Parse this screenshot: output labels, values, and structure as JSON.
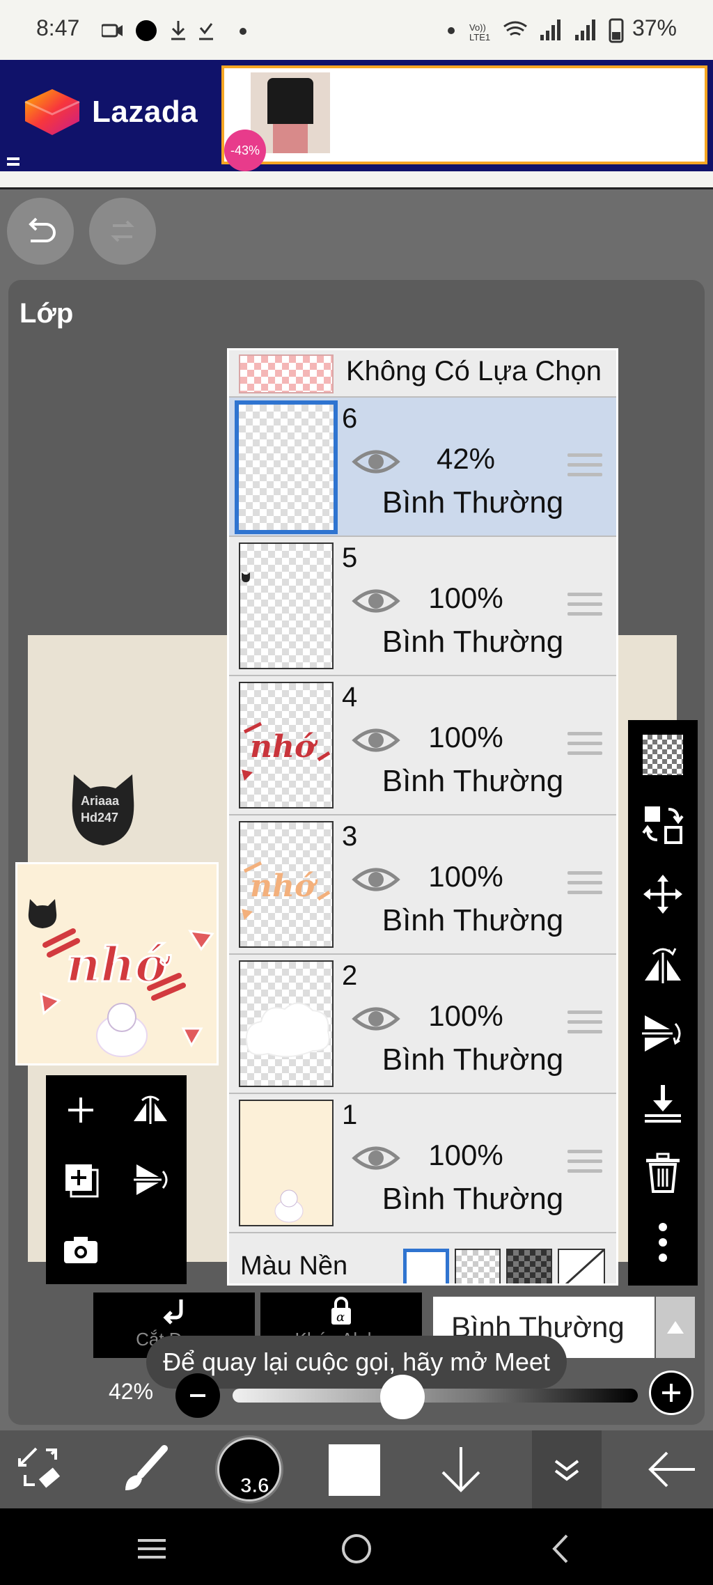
{
  "status_bar": {
    "time": "8:47",
    "battery": "37%"
  },
  "ad": {
    "brand": "Lazada",
    "discount": "-43%"
  },
  "panel": {
    "title": "Lớp"
  },
  "preview": {
    "watermark_line1": "Ariaaa",
    "watermark_line2": "Hd247"
  },
  "layers": {
    "selection_label": "Không Có Lựa Chọn",
    "items": [
      {
        "number": "6",
        "opacity": "42%",
        "mode": "Bình Thường",
        "selected": true
      },
      {
        "number": "5",
        "opacity": "100%",
        "mode": "Bình Thường",
        "selected": false
      },
      {
        "number": "4",
        "opacity": "100%",
        "mode": "Bình Thường",
        "selected": false
      },
      {
        "number": "3",
        "opacity": "100%",
        "mode": "Bình Thường",
        "selected": false
      },
      {
        "number": "2",
        "opacity": "100%",
        "mode": "Bình Thường",
        "selected": false
      },
      {
        "number": "1",
        "opacity": "100%",
        "mode": "Bình Thường",
        "selected": false
      }
    ],
    "background_label": "Màu Nền"
  },
  "controls": {
    "clip_label": "Cắt Đoạn",
    "alpha_lock_label": "Khóa Alpha",
    "blend_mode": "Bình Thường",
    "opacity_value": "42%",
    "opacity_fraction": 0.42
  },
  "toast": {
    "text": "Để quay lại cuộc gọi, hãy mở Meet"
  },
  "bottom_toolbar": {
    "brush_size": "3.6"
  },
  "icons": {
    "undo": "undo-icon",
    "redo": "redo-icon",
    "eye": "eye-icon",
    "checker": "checkerboard-icon",
    "move": "move-icon",
    "trash": "trash-icon"
  },
  "colors": {
    "selected_row": "#ccd9ec",
    "selected_border": "#2f74d0",
    "ad_bg": "#10126a"
  }
}
